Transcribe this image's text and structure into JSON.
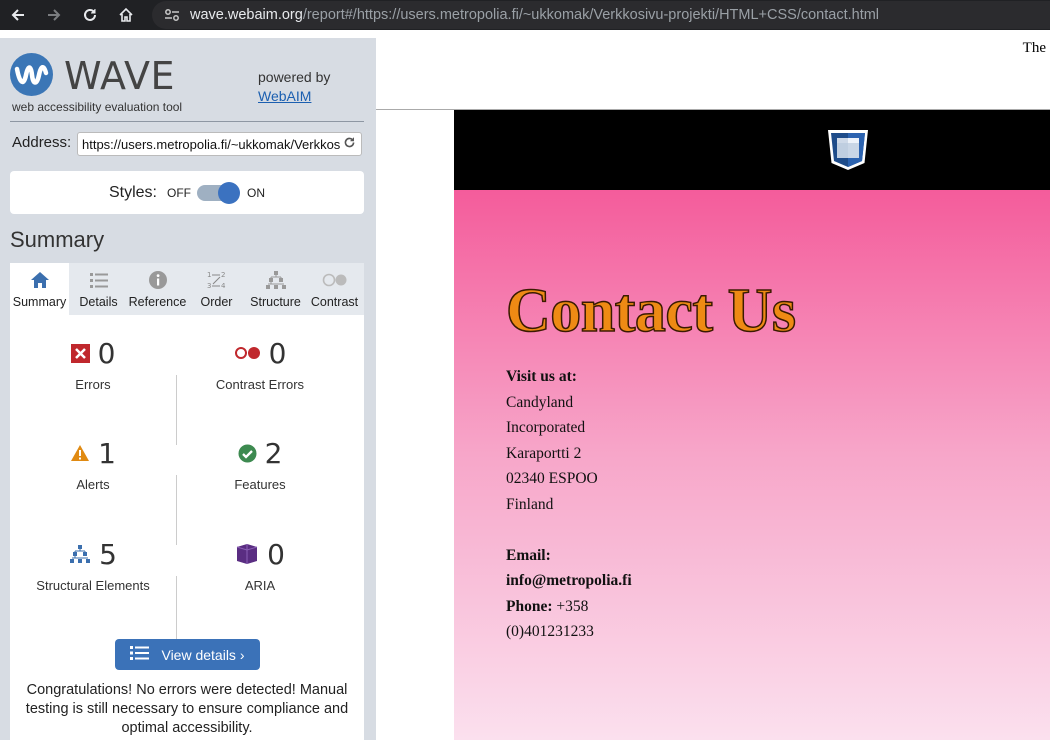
{
  "browser": {
    "url_host": "wave.webaim.org",
    "url_rest": "/report#/https://users.metropolia.fi/~ukkomak/Verkkosivu-projekti/HTML+CSS/contact.html"
  },
  "wave": {
    "logo_text": "WAVE",
    "subtitle": "web accessibility evaluation tool",
    "powered_by": "powered by",
    "webaim_link": "WebAIM",
    "address_label": "Address:",
    "address_value": "https://users.metropolia.fi/~ukkomak/Verkkosivu-projekti/HTML+CSS/contact.html",
    "styles_label": "Styles:",
    "styles_off": "OFF",
    "styles_on": "ON",
    "styles_state": "on",
    "summary_title": "Summary",
    "tabs": [
      {
        "label": "Summary",
        "icon": "home-icon",
        "active": true
      },
      {
        "label": "Details",
        "icon": "list-icon",
        "active": false
      },
      {
        "label": "Reference",
        "icon": "info-icon",
        "active": false
      },
      {
        "label": "Order",
        "icon": "order-icon",
        "active": false
      },
      {
        "label": "Structure",
        "icon": "structure-icon",
        "active": false
      },
      {
        "label": "Contrast",
        "icon": "contrast-icon",
        "active": false
      }
    ],
    "stats": {
      "errors": {
        "count": "0",
        "label": "Errors"
      },
      "contrast_errors": {
        "count": "0",
        "label": "Contrast Errors"
      },
      "alerts": {
        "count": "1",
        "label": "Alerts"
      },
      "features": {
        "count": "2",
        "label": "Features"
      },
      "structural": {
        "count": "5",
        "label": "Structural Elements"
      },
      "aria": {
        "count": "0",
        "label": "ARIA"
      }
    },
    "view_details": "View details ›",
    "congrats": "Congratulations! No errors were detected! Manual testing is still necessary to ensure compliance and optimal accessibility."
  },
  "page": {
    "top_text": "The",
    "heading": "Contact Us",
    "visit_label": "Visit us at:",
    "address_lines": [
      "Candyland",
      "Incorporated",
      "Karaportti 2",
      "02340 ESPOO",
      "Finland"
    ],
    "email_label": "Email:",
    "email_value": "info@metropolia.fi",
    "phone_label": "Phone:",
    "phone_value_1": "+358",
    "phone_value_2": "(0)401231233"
  },
  "colors": {
    "wave_blue": "#3b76b6",
    "error_red": "#c0282d",
    "alert_orange": "#e08a12",
    "feature_green": "#3d8a50",
    "aria_purple": "#5a2d82",
    "heading_orange": "#ee8a14"
  }
}
